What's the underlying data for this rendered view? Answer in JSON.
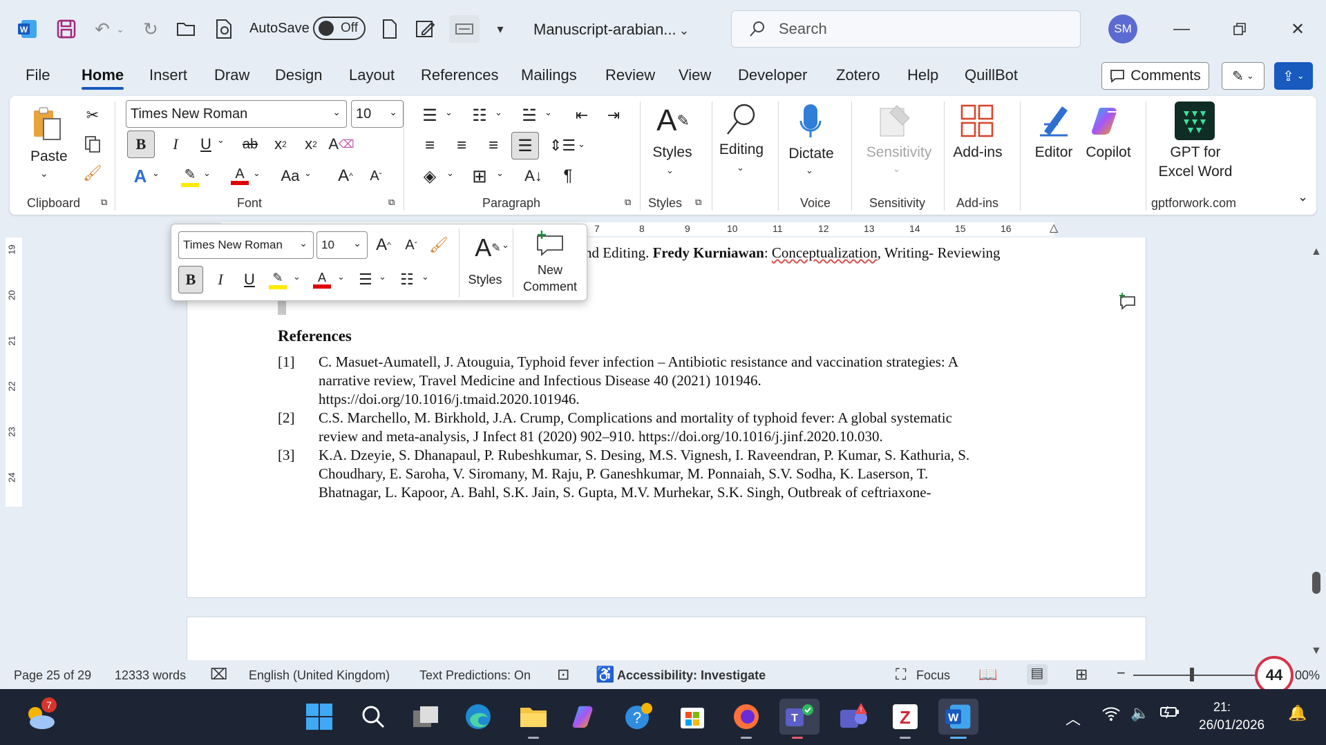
{
  "titlebar": {
    "autosave_label": "AutoSave",
    "autosave_state": "Off",
    "doc_title": "Manuscript-arabian...",
    "search_placeholder": "Search",
    "avatar_initials": "SM"
  },
  "tabs": [
    "File",
    "Home",
    "Insert",
    "Draw",
    "Design",
    "Layout",
    "References",
    "Mailings",
    "Review",
    "View",
    "Developer",
    "Zotero",
    "Help",
    "QuillBot"
  ],
  "active_tab": "Home",
  "comments_label": "Comments",
  "ribbon": {
    "clipboard": {
      "paste": "Paste",
      "group": "Clipboard"
    },
    "font": {
      "name": "Times New Roman",
      "size": "10",
      "group": "Font"
    },
    "paragraph": {
      "group": "Paragraph"
    },
    "styles": {
      "label": "Styles",
      "group": "Styles"
    },
    "editing": {
      "label": "Editing"
    },
    "voice": {
      "label": "Dictate",
      "group": "Voice"
    },
    "sensitivity": {
      "label": "Sensitivity",
      "group": "Sensitivity"
    },
    "addins": {
      "label": "Add-ins",
      "group": "Add-ins"
    },
    "editor": {
      "label": "Editor"
    },
    "copilot": {
      "label": "Copilot"
    },
    "gpt": {
      "label1": "GPT for",
      "label2": "Excel Word",
      "group": "gptforwork.com"
    }
  },
  "ruler": {
    "numbers": [
      "7",
      "8",
      "9",
      "10",
      "11",
      "12",
      "13",
      "14",
      "15",
      "16"
    ],
    "vertical": [
      "19",
      "20",
      "21",
      "22",
      "23",
      "24"
    ]
  },
  "mini_toolbar": {
    "font": "Times New Roman",
    "size": "10",
    "styles": "Styles",
    "new_comment_1": "New",
    "new_comment_2": "Comment"
  },
  "document": {
    "top_line_pre": "nd Editing. ",
    "top_line_name": "Fredy Kurniawan",
    "top_line_colon": ": ",
    "top_line_concept": "Conceptualization",
    "top_line_post": ", Writing- Reviewing",
    "heading": "References",
    "refs": [
      {
        "num": "[1]",
        "lines": [
          "C. Masuet-Aumatell, J. Atouguia, Typhoid fever infection – Antibiotic resistance and vaccination strategies: A",
          "narrative review, Travel Medicine and Infectious Disease 40 (2021) 101946.",
          "https://doi.org/10.1016/j.tmaid.2020.101946."
        ]
      },
      {
        "num": "[2]",
        "lines": [
          "C.S. Marchello, M. Birkhold, J.A. Crump, Complications and mortality of typhoid fever: A global systematic",
          "review and meta-analysis, J Infect 81 (2020) 902–910. https://doi.org/10.1016/j.jinf.2020.10.030."
        ]
      },
      {
        "num": "[3]",
        "lines": [
          "K.A. Dzeyie, S. Dhanapaul, P. Rubeshkumar, S. Desing, M.S. Vignesh, I. Raveendran, P. Kumar, S. Kathuria, S.",
          "Choudhary, E. Saroha, V. Siromany, M. Raju, P. Ganeshkumar, M. Ponnaiah, S.V. Sodha, K. Laserson, T.",
          "Bhatnagar, L. Kapoor, A. Bahl, S.K. Jain, S. Gupta, M.V. Murhekar, S.K. Singh, Outbreak of ceftriaxone-"
        ]
      }
    ]
  },
  "status": {
    "page": "Page 25 of 29",
    "words": "12333 words",
    "language": "English (United Kingdom)",
    "predictions": "Text Predictions: On",
    "accessibility": "Accessibility: Investigate",
    "focus": "Focus",
    "zoom": "00%",
    "badge": "44"
  },
  "taskbar": {
    "weather_badge": "7",
    "time": "21:",
    "date": "26/01/2026"
  }
}
